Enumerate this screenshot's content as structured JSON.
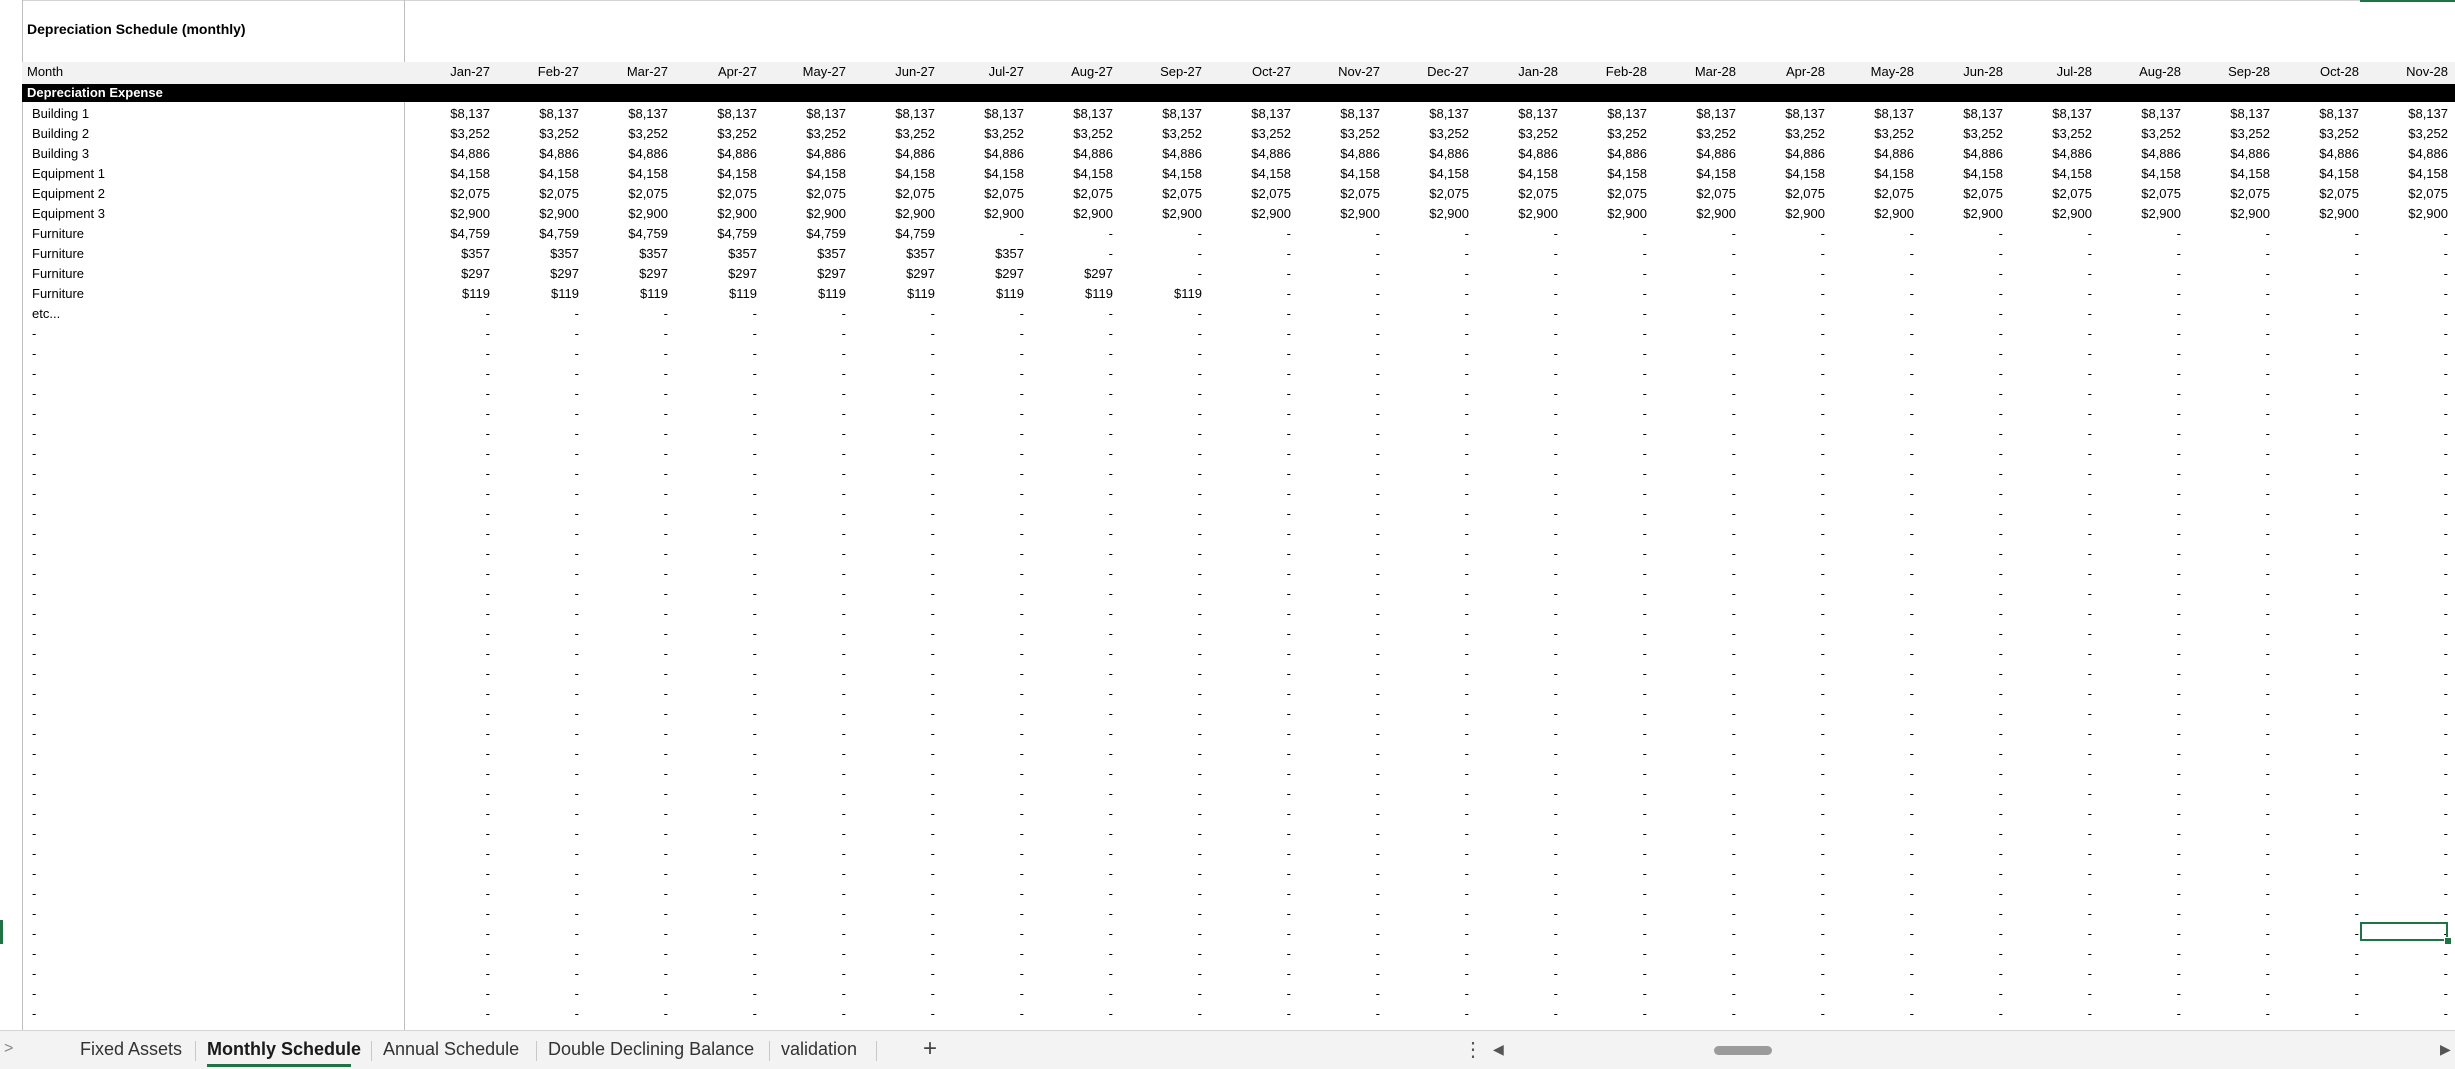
{
  "sheet": {
    "title": "Depreciation Schedule (monthly)",
    "month_label": "Month",
    "section_label": "Depreciation Expense",
    "months": [
      "Jan-27",
      "Feb-27",
      "Mar-27",
      "Apr-27",
      "May-27",
      "Jun-27",
      "Jul-27",
      "Aug-27",
      "Sep-27",
      "Oct-27",
      "Nov-27",
      "Dec-27",
      "Jan-28",
      "Feb-28",
      "Mar-28",
      "Apr-28",
      "May-28",
      "Jun-28",
      "Jul-28",
      "Aug-28",
      "Sep-28",
      "Oct-28",
      "Nov-28"
    ],
    "rows": [
      {
        "label": "Building 1",
        "values": [
          "$8,137",
          "$8,137",
          "$8,137",
          "$8,137",
          "$8,137",
          "$8,137",
          "$8,137",
          "$8,137",
          "$8,137",
          "$8,137",
          "$8,137",
          "$8,137",
          "$8,137",
          "$8,137",
          "$8,137",
          "$8,137",
          "$8,137",
          "$8,137",
          "$8,137",
          "$8,137",
          "$8,137",
          "$8,137",
          "$8,137"
        ]
      },
      {
        "label": "Building 2",
        "values": [
          "$3,252",
          "$3,252",
          "$3,252",
          "$3,252",
          "$3,252",
          "$3,252",
          "$3,252",
          "$3,252",
          "$3,252",
          "$3,252",
          "$3,252",
          "$3,252",
          "$3,252",
          "$3,252",
          "$3,252",
          "$3,252",
          "$3,252",
          "$3,252",
          "$3,252",
          "$3,252",
          "$3,252",
          "$3,252",
          "$3,252"
        ]
      },
      {
        "label": "Building 3",
        "values": [
          "$4,886",
          "$4,886",
          "$4,886",
          "$4,886",
          "$4,886",
          "$4,886",
          "$4,886",
          "$4,886",
          "$4,886",
          "$4,886",
          "$4,886",
          "$4,886",
          "$4,886",
          "$4,886",
          "$4,886",
          "$4,886",
          "$4,886",
          "$4,886",
          "$4,886",
          "$4,886",
          "$4,886",
          "$4,886",
          "$4,886"
        ]
      },
      {
        "label": "Equipment 1",
        "values": [
          "$4,158",
          "$4,158",
          "$4,158",
          "$4,158",
          "$4,158",
          "$4,158",
          "$4,158",
          "$4,158",
          "$4,158",
          "$4,158",
          "$4,158",
          "$4,158",
          "$4,158",
          "$4,158",
          "$4,158",
          "$4,158",
          "$4,158",
          "$4,158",
          "$4,158",
          "$4,158",
          "$4,158",
          "$4,158",
          "$4,158"
        ]
      },
      {
        "label": "Equipment 2",
        "values": [
          "$2,075",
          "$2,075",
          "$2,075",
          "$2,075",
          "$2,075",
          "$2,075",
          "$2,075",
          "$2,075",
          "$2,075",
          "$2,075",
          "$2,075",
          "$2,075",
          "$2,075",
          "$2,075",
          "$2,075",
          "$2,075",
          "$2,075",
          "$2,075",
          "$2,075",
          "$2,075",
          "$2,075",
          "$2,075",
          "$2,075"
        ]
      },
      {
        "label": "Equipment 3",
        "values": [
          "$2,900",
          "$2,900",
          "$2,900",
          "$2,900",
          "$2,900",
          "$2,900",
          "$2,900",
          "$2,900",
          "$2,900",
          "$2,900",
          "$2,900",
          "$2,900",
          "$2,900",
          "$2,900",
          "$2,900",
          "$2,900",
          "$2,900",
          "$2,900",
          "$2,900",
          "$2,900",
          "$2,900",
          "$2,900",
          "$2,900"
        ]
      },
      {
        "label": "Furniture",
        "values": [
          "$4,759",
          "$4,759",
          "$4,759",
          "$4,759",
          "$4,759",
          "$4,759",
          "-",
          "-",
          "-",
          "-",
          "-",
          "-",
          "-",
          "-",
          "-",
          "-",
          "-",
          "-",
          "-",
          "-",
          "-",
          "-",
          "-"
        ]
      },
      {
        "label": "Furniture",
        "values": [
          "$357",
          "$357",
          "$357",
          "$357",
          "$357",
          "$357",
          "$357",
          "-",
          "-",
          "-",
          "-",
          "-",
          "-",
          "-",
          "-",
          "-",
          "-",
          "-",
          "-",
          "-",
          "-",
          "-",
          "-"
        ]
      },
      {
        "label": "Furniture",
        "values": [
          "$297",
          "$297",
          "$297",
          "$297",
          "$297",
          "$297",
          "$297",
          "$297",
          "-",
          "-",
          "-",
          "-",
          "-",
          "-",
          "-",
          "-",
          "-",
          "-",
          "-",
          "-",
          "-",
          "-",
          "-"
        ]
      },
      {
        "label": "Furniture",
        "values": [
          "$119",
          "$119",
          "$119",
          "$119",
          "$119",
          "$119",
          "$119",
          "$119",
          "$119",
          "-",
          "-",
          "-",
          "-",
          "-",
          "-",
          "-",
          "-",
          "-",
          "-",
          "-",
          "-",
          "-",
          "-"
        ]
      },
      {
        "label": "etc...",
        "values": [
          "-",
          "-",
          "-",
          "-",
          "-",
          "-",
          "-",
          "-",
          "-",
          "-",
          "-",
          "-",
          "-",
          "-",
          "-",
          "-",
          "-",
          "-",
          "-",
          "-",
          "-",
          "-",
          "-"
        ]
      }
    ],
    "blank_label": "-",
    "blank_value": "-",
    "blank_row_count": 35
  },
  "tabs": [
    {
      "label": "Fixed Assets",
      "active": false
    },
    {
      "label": "Monthly Schedule",
      "active": true
    },
    {
      "label": "Annual Schedule",
      "active": false
    },
    {
      "label": "Double Declining Balance",
      "active": false
    },
    {
      "label": "validation",
      "active": false
    }
  ],
  "tabbar": {
    "add_sheet_label": "+",
    "more_options_label": "⋮",
    "scroll_left_label": "◀",
    "scroll_right_label": "▶",
    "prev_sheets_label": ">"
  },
  "colors": {
    "accent": "#217346",
    "header_band": "#f2f2f2",
    "section_band": "#000000"
  },
  "icons": [
    "add-sheet-icon",
    "more-options-icon",
    "scroll-left-icon",
    "scroll-right-icon"
  ]
}
